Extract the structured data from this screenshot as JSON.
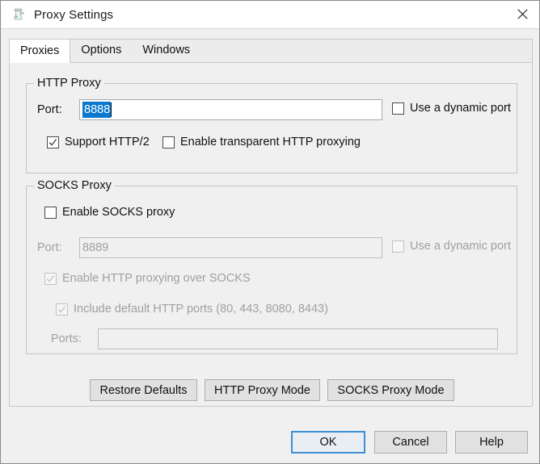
{
  "window": {
    "title": "Proxy Settings",
    "app_icon": "proxy-app-icon",
    "close_icon": "close-icon"
  },
  "tabs": [
    {
      "label": "Proxies",
      "selected": true
    },
    {
      "label": "Options",
      "selected": false
    },
    {
      "label": "Windows",
      "selected": false
    }
  ],
  "http_proxy": {
    "group_title": "HTTP Proxy",
    "port_label": "Port:",
    "port_value": "8888",
    "port_placeholder": "",
    "dynamic_port_label": "Use a dynamic port",
    "dynamic_port_checked": false,
    "support_http2_label": "Support HTTP/2",
    "support_http2_checked": true,
    "transparent_label": "Enable transparent HTTP proxying",
    "transparent_checked": false
  },
  "socks_proxy": {
    "group_title": "SOCKS Proxy",
    "enable_label": "Enable SOCKS proxy",
    "enable_checked": false,
    "port_label": "Port:",
    "port_value": "8889",
    "dynamic_port_label": "Use a dynamic port",
    "dynamic_port_checked": false,
    "http_over_socks_label": "Enable HTTP proxying over SOCKS",
    "http_over_socks_checked": true,
    "default_ports_label": "Include default HTTP ports (80, 443, 8080, 8443)",
    "default_ports_checked": true,
    "ports_label": "Ports:",
    "ports_value": "",
    "ports_placeholder": ""
  },
  "mode_buttons": {
    "restore_defaults": "Restore Defaults",
    "http_proxy_mode": "HTTP Proxy Mode",
    "socks_proxy_mode": "SOCKS Proxy Mode"
  },
  "dialog_buttons": {
    "ok": "OK",
    "cancel": "Cancel",
    "help": "Help"
  },
  "colors": {
    "selection_blue": "#0b78d0",
    "default_button_border": "#3d8fd1",
    "window_bg": "#f0f0f0",
    "disabled_text": "#a0a0a0"
  }
}
